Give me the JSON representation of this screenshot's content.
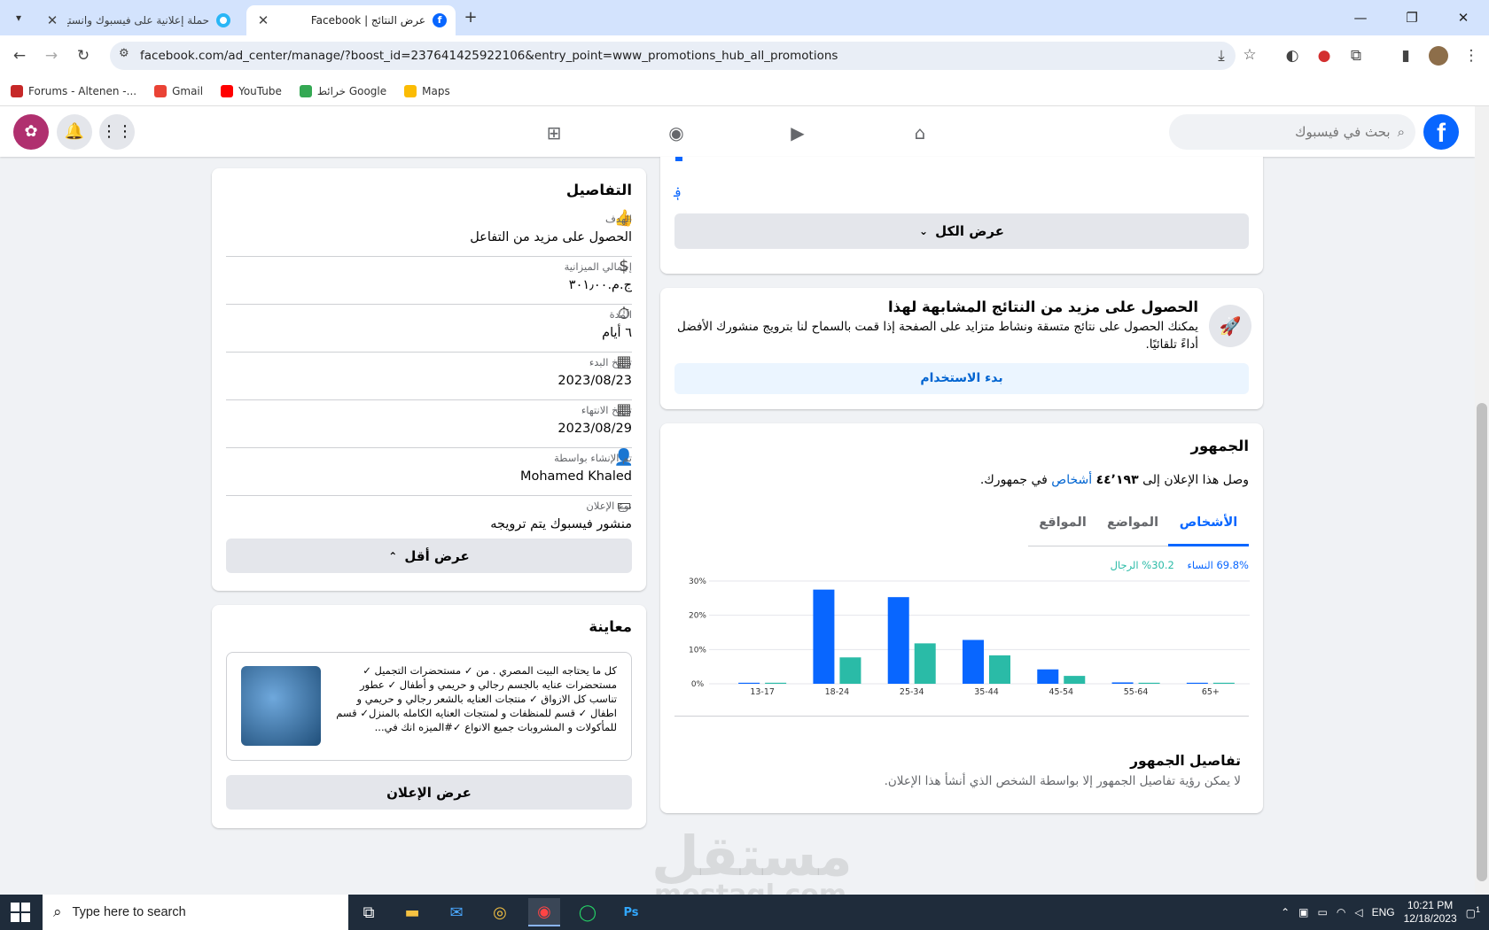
{
  "browser": {
    "tabs": [
      {
        "title": "حملة إعلانية على فيسبوك وانستغ..."
      },
      {
        "title": "عرض النتائج | Facebook"
      }
    ],
    "url": "facebook.com/ad_center/manage/?boost_id=237641425922106&entry_point=www_promotions_hub_all_promotions",
    "bookmarks": [
      "Forums - Altenen -...",
      "Gmail",
      "YouTube",
      "خرائط Google",
      "Maps"
    ]
  },
  "fb": {
    "logo": "f",
    "search_placeholder": "بحث في فيسبوك"
  },
  "details": {
    "title": "التفاصيل",
    "rows": [
      {
        "label": "الهدف",
        "value": "الحصول على مزيد من التفاعل"
      },
      {
        "label": "إجمالي الميزانية",
        "value": "ج.م.٣٠١٫٠٠"
      },
      {
        "label": "المدة",
        "value": "٦ أيام"
      },
      {
        "label": "تاريخ البدء",
        "value": "2023/08/23"
      },
      {
        "label": "تاريخ الانتهاء",
        "value": "2023/08/29"
      },
      {
        "label": "تم الإنشاء بواسطة",
        "value": "Mohamed Khaled"
      },
      {
        "label": "نوع الإعلان",
        "value": "منشور فيسبوك يتم ترويجه"
      }
    ],
    "show_less": "عرض أقل"
  },
  "preview": {
    "title": "معاينة",
    "text": "كل ما يحتاجه البيت المصري . من ✓ مستحضرات التجميل ✓ مستحضرات عنايه بالجسم رجالي و حريمي و أطفال ✓ عطور تناسب كل الازواق ✓ منتجات العنايه بالشعر رجالي و حريمي و اطفال ✓ قسم للمنظفات و لمنتجات العنايه الكامله بالمنزل✓ قسم للمأكولات و المشروبات جميع الانواع ✓#الميزه انك في...",
    "view_ad": "عرض الإعلان"
  },
  "top_card": {
    "mark": "؋",
    "show_all": "عرض الكل"
  },
  "similar": {
    "title": "الحصول على مزيد من النتائج المشابهة لهذا",
    "desc": "يمكنك الحصول على نتائج متسقة ونشاط متزايد على الصفحة إذا قمت بالسماح لنا بترويج منشورك الأفضل أداءً تلقائيًا.",
    "cta": "بدء الاستخدام"
  },
  "audience": {
    "title": "الجمهور",
    "reach_prefix": "وصل هذا الإعلان إلى",
    "reach_count": "٤٤٬١٩٣",
    "reach_link": "أشخاص",
    "reach_suffix": "في جمهورك.",
    "tabs": [
      "الأشخاص",
      "المواضع",
      "المواقع"
    ],
    "women_pct": "69.8%",
    "women_label": "النساء",
    "men_pct": "30.2%",
    "men_label": "الرجال",
    "details_title": "تفاصيل الجمهور",
    "details_text": "لا يمكن رؤية تفاصيل الجمهور إلا بواسطة الشخص الذي أنشأ هذا الإعلان.",
    "colors": {
      "women": "#0866ff",
      "men": "#2abba7"
    }
  },
  "chart_data": {
    "type": "bar",
    "categories": [
      "13-17",
      "18-24",
      "25-34",
      "35-44",
      "45-54",
      "55-64",
      "65+"
    ],
    "series": [
      {
        "name": "النساء",
        "values": [
          0.3,
          27.5,
          25.3,
          12.8,
          4.2,
          0.4,
          0.3
        ]
      },
      {
        "name": "الرجال",
        "values": [
          0.3,
          7.7,
          11.8,
          8.3,
          2.3,
          0.3,
          0.3
        ]
      }
    ],
    "yticks": [
      "0%",
      "10%",
      "20%",
      "30%"
    ],
    "ylim": [
      0,
      30
    ],
    "grid": true
  },
  "taskbar": {
    "search_placeholder": "Type here to search",
    "lang": "ENG",
    "time": "10:21 PM",
    "date": "12/18/2023",
    "notif_count": "1"
  },
  "watermark": {
    "ar": "مستقل",
    "en": "mostaql.com"
  }
}
